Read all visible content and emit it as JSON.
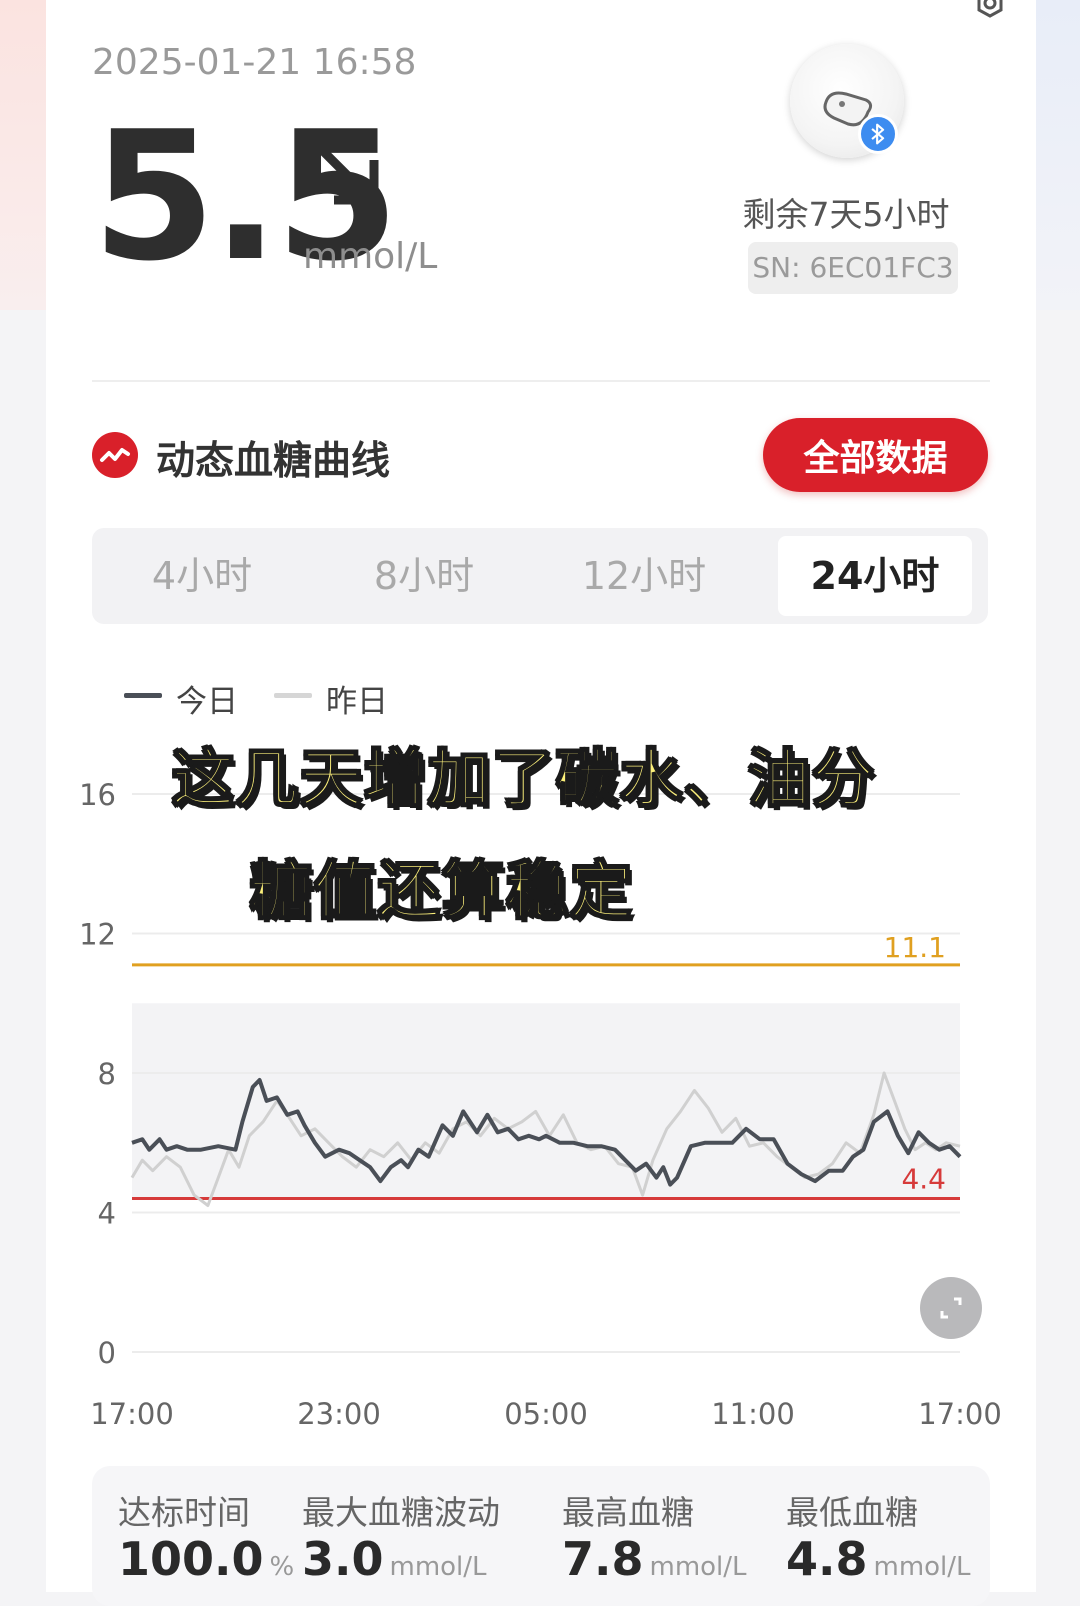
{
  "header": {
    "timestamp": "2025-01-21 16:58",
    "glucose_value": "5.5",
    "glucose_unit": "mmol/L",
    "trend_icon": "arrow-down-right-icon",
    "sensor_remaining": "剩余7天5小时",
    "sensor_sn": "SN: 6EC01FC3"
  },
  "section": {
    "title": "动态血糖曲线",
    "all_data_button": "全部数据"
  },
  "tabs": [
    {
      "label": "4小时",
      "active": false
    },
    {
      "label": "8小时",
      "active": false
    },
    {
      "label": "12小时",
      "active": false
    },
    {
      "label": "24小时",
      "active": true
    }
  ],
  "legend": {
    "today": "今日",
    "yesterday": "昨日"
  },
  "overlay_text": {
    "line1": "这几天增加了碳水、油分",
    "line2": "糖值还算稳定"
  },
  "chart_data": {
    "type": "line",
    "y_ticks": [
      "16",
      "12",
      "8",
      "4",
      "0"
    ],
    "x_ticks": [
      "17:00",
      "23:00",
      "05:00",
      "11:00",
      "17:00"
    ],
    "ylim": [
      0,
      16
    ],
    "high_threshold": {
      "value": 11.1,
      "label": "11.1",
      "color": "#e0a020"
    },
    "low_threshold": {
      "value": 4.4,
      "label": "4.4",
      "color": "#d63a3a"
    },
    "target_band": [
      4.4,
      10
    ],
    "series": [
      {
        "name": "今日",
        "color": "#4a4f57",
        "x_hours": [
          0,
          0.3,
          0.5,
          0.8,
          1,
          1.3,
          1.6,
          2,
          2.5,
          3,
          3.2,
          3.5,
          3.7,
          3.9,
          4.2,
          4.5,
          4.8,
          5,
          5.3,
          5.6,
          6,
          6.3,
          6.6,
          6.9,
          7.2,
          7.5,
          7.8,
          8,
          8.3,
          8.6,
          9,
          9.3,
          9.6,
          10,
          10.3,
          10.6,
          10.9,
          11.2,
          11.5,
          11.8,
          12,
          12.4,
          12.8,
          13.2,
          13.6,
          14,
          14.3,
          14.6,
          14.9,
          15.2,
          15.4,
          15.6,
          15.8,
          16.2,
          16.6,
          17,
          17.4,
          17.8,
          18.2,
          18.6,
          19,
          19.4,
          19.8,
          20.2,
          20.6,
          20.9,
          21.2,
          21.5,
          21.9,
          22.2,
          22.5,
          22.8,
          23.1,
          23.4,
          23.7,
          24
        ],
        "values": [
          6.0,
          6.1,
          5.8,
          6.1,
          5.8,
          5.9,
          5.8,
          5.8,
          5.9,
          5.8,
          6.6,
          7.6,
          7.8,
          7.2,
          7.3,
          6.8,
          6.9,
          6.5,
          6.0,
          5.6,
          5.8,
          5.7,
          5.5,
          5.3,
          4.9,
          5.3,
          5.5,
          5.3,
          5.8,
          5.6,
          6.5,
          6.2,
          6.9,
          6.3,
          6.8,
          6.3,
          6.4,
          6.1,
          6.2,
          6.1,
          6.2,
          6.0,
          6.0,
          5.9,
          5.9,
          5.8,
          5.5,
          5.2,
          5.4,
          5.0,
          5.3,
          4.8,
          5.0,
          5.9,
          6.0,
          6.0,
          6.0,
          6.4,
          6.1,
          6.1,
          5.4,
          5.1,
          4.9,
          5.2,
          5.2,
          5.6,
          5.8,
          6.6,
          6.9,
          6.2,
          5.7,
          6.3,
          6.0,
          5.8,
          5.9,
          5.6
        ]
      },
      {
        "name": "昨日",
        "color": "#d0d0d0",
        "x_hours": [
          0,
          0.3,
          0.6,
          1,
          1.4,
          1.8,
          2.2,
          2.5,
          2.8,
          3.1,
          3.4,
          3.8,
          4.2,
          4.5,
          4.9,
          5.3,
          5.7,
          6.1,
          6.5,
          6.9,
          7.3,
          7.7,
          8.1,
          8.5,
          8.9,
          9.3,
          9.7,
          10.1,
          10.5,
          10.9,
          11.3,
          11.7,
          12.1,
          12.5,
          12.9,
          13.3,
          13.7,
          14.1,
          14.5,
          14.8,
          15.1,
          15.5,
          15.9,
          16.3,
          16.7,
          17.1,
          17.5,
          17.9,
          18.3,
          18.7,
          19.1,
          19.5,
          19.9,
          20.3,
          20.7,
          21.1,
          21.5,
          21.8,
          22.1,
          22.4,
          22.7,
          23,
          23.3,
          23.6,
          24
        ],
        "values": [
          5.0,
          5.5,
          5.2,
          5.6,
          5.3,
          4.5,
          4.2,
          5.0,
          5.8,
          5.3,
          6.2,
          6.6,
          7.2,
          6.8,
          6.2,
          6.4,
          6.0,
          5.6,
          5.3,
          5.8,
          5.6,
          6.0,
          5.5,
          6.0,
          5.7,
          6.4,
          6.6,
          6.2,
          6.7,
          6.4,
          6.6,
          6.9,
          6.2,
          6.8,
          6.0,
          5.8,
          5.9,
          5.4,
          5.3,
          4.5,
          5.5,
          6.4,
          6.9,
          7.5,
          7.0,
          6.3,
          6.7,
          5.9,
          6.0,
          5.6,
          5.3,
          5.0,
          5.1,
          5.4,
          6.0,
          5.7,
          6.8,
          8.0,
          7.2,
          6.4,
          5.8,
          6.0,
          5.8,
          6.0,
          5.9
        ]
      }
    ]
  },
  "stats": [
    {
      "label": "达标时间",
      "value": "100.0",
      "unit": "%"
    },
    {
      "label": "最大血糖波动",
      "value": "3.0",
      "unit": "mmol/L"
    },
    {
      "label": "最高血糖",
      "value": "7.8",
      "unit": "mmol/L"
    },
    {
      "label": "最低血糖",
      "value": "4.8",
      "unit": "mmol/L"
    }
  ]
}
